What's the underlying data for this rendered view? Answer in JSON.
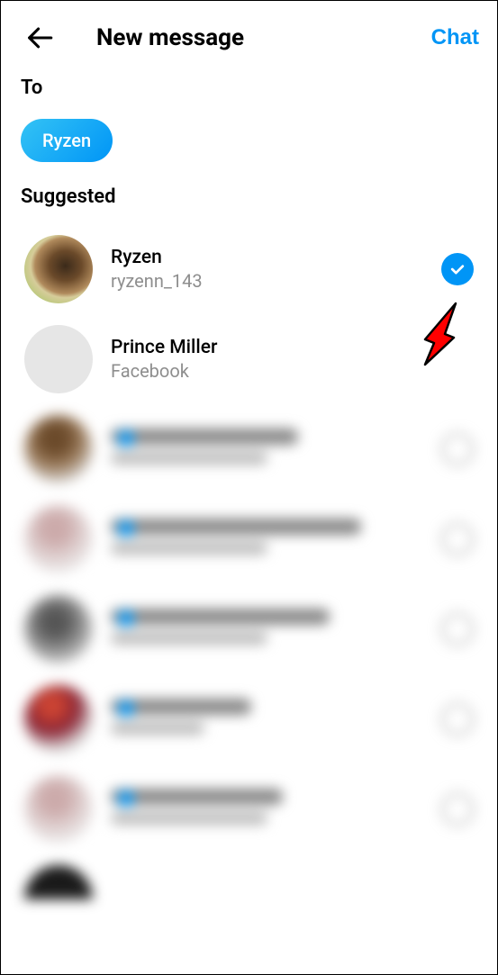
{
  "header": {
    "title": "New message",
    "action_label": "Chat"
  },
  "to": {
    "label": "To",
    "chips": [
      "Ryzen"
    ]
  },
  "sections": {
    "suggested_label": "Suggested"
  },
  "contacts": [
    {
      "name": "Ryzen",
      "subtitle": "ryzenn_143",
      "selected": true,
      "avatar": "dog",
      "blurred": false
    },
    {
      "name": "Prince Miller",
      "subtitle": "Facebook",
      "selected": false,
      "avatar": "blank",
      "blurred": false,
      "no_checkbox": true
    },
    {
      "name": "",
      "subtitle": "",
      "selected": false,
      "avatar": "brown",
      "blurred": true,
      "verified": true
    },
    {
      "name": "",
      "subtitle": "",
      "selected": false,
      "avatar": "light",
      "blurred": true,
      "verified": true
    },
    {
      "name": "",
      "subtitle": "",
      "selected": false,
      "avatar": "gray",
      "blurred": true,
      "verified": true
    },
    {
      "name": "",
      "subtitle": "",
      "selected": false,
      "avatar": "pink",
      "blurred": true,
      "verified": true
    },
    {
      "name": "",
      "subtitle": "",
      "selected": false,
      "avatar": "light",
      "blurred": true,
      "verified": true
    },
    {
      "name": "",
      "subtitle": "",
      "selected": false,
      "avatar": "dark",
      "blurred": true,
      "verified": false,
      "partial": true
    }
  ],
  "colors": {
    "accent": "#0095f6"
  }
}
